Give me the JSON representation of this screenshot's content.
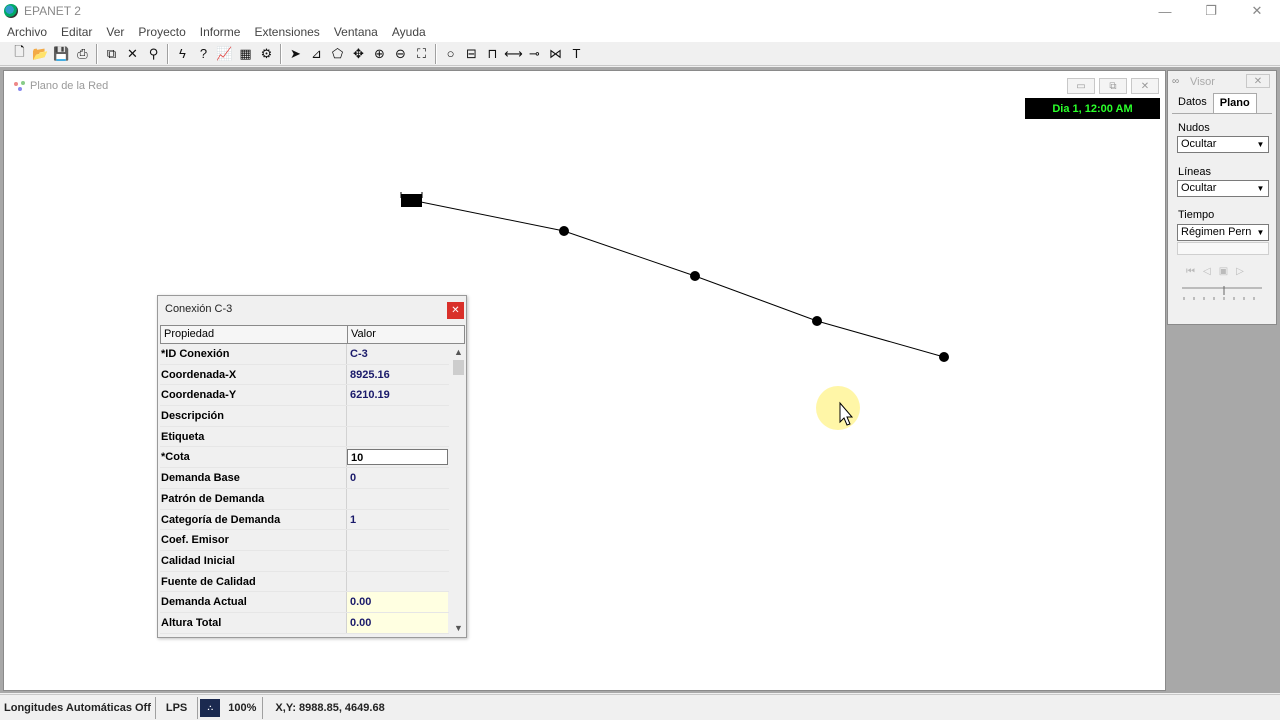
{
  "app": {
    "title": "EPANET 2"
  },
  "window_controls": {
    "minimize": "—",
    "restore": "❐",
    "close": "✕"
  },
  "menu": [
    "Archivo",
    "Editar",
    "Ver",
    "Proyecto",
    "Informe",
    "Extensiones",
    "Ventana",
    "Ayuda"
  ],
  "map": {
    "title": "Plano de la Red",
    "time": "Dia 1, 12:00 AM",
    "controls": {
      "minimize": "▭",
      "maximize": "⧉",
      "close": "✕"
    }
  },
  "visor": {
    "title": "Visor",
    "tabs": [
      "Datos",
      "Plano"
    ],
    "nodes_label": "Nudos",
    "nodes_value": "Ocultar",
    "links_label": "Líneas",
    "links_value": "Ocultar",
    "time_label": "Tiempo",
    "time_value": "Régimen Pern"
  },
  "property_editor": {
    "title": "Conexión C-3",
    "col_property": "Propiedad",
    "col_value": "Valor",
    "rows": [
      {
        "k": "*ID Conexión",
        "v": "C-3"
      },
      {
        "k": "Coordenada-X",
        "v": "8925.16"
      },
      {
        "k": "Coordenada-Y",
        "v": "6210.19"
      },
      {
        "k": "Descripción",
        "v": ""
      },
      {
        "k": "Etiqueta",
        "v": ""
      },
      {
        "k": "*Cota",
        "v": "10"
      },
      {
        "k": "Demanda Base",
        "v": "0"
      },
      {
        "k": "Patrón de Demanda",
        "v": ""
      },
      {
        "k": "Categoría de Demanda",
        "v": "1"
      },
      {
        "k": "Coef. Emisor",
        "v": ""
      },
      {
        "k": "Calidad Inicial",
        "v": ""
      },
      {
        "k": "Fuente de Calidad",
        "v": ""
      },
      {
        "k": "Demanda Actual",
        "v": "0.00"
      },
      {
        "k": "Altura Total",
        "v": "0.00"
      }
    ]
  },
  "status": {
    "auto_length": "Longitudes Automáticas Off",
    "units": "LPS",
    "zoom": "100%",
    "coords": "X,Y: 8988.85, 4649.68"
  },
  "colors": {
    "time_text": "#2aff2a",
    "close_red": "#d9302a",
    "cursor_highlight": "#fff59d"
  }
}
